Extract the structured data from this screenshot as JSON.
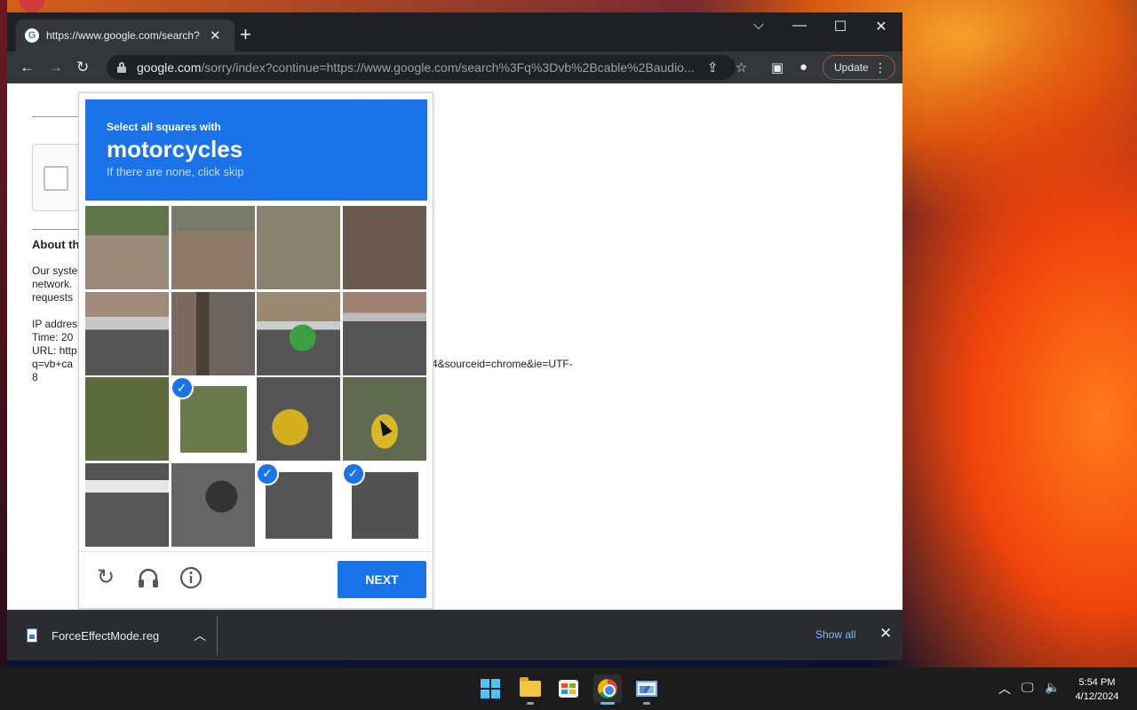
{
  "browser": {
    "tab_title": "https://www.google.com/search?",
    "favicon_letter": "G",
    "url_host": "google.com",
    "url_rest": "/sorry/index?continue=https://www.google.com/search%3Fq%3Dvb%2Bcable%2Baudio...",
    "update_label": "Update"
  },
  "page": {
    "about_heading": "About th",
    "p1": "Our syste",
    "p2": "network.",
    "p3": "requests",
    "ip": "IP addres",
    "time": "Time: 20",
    "url": "URL: http",
    "q": "q=vb+ca",
    "eight": "8",
    "url_tail": "4&sourceid=chrome&ie=UTF-"
  },
  "captcha": {
    "instruction": "Select all squares with",
    "object": "motorcycles",
    "subtext": "If there are none, click skip",
    "next_label": "NEXT",
    "selected_tiles": [
      9,
      14,
      15
    ]
  },
  "downloads": {
    "file_name": "ForceEffectMode.reg",
    "show_all": "Show all"
  },
  "taskbar": {
    "time": "5:54 PM",
    "date": "4/12/2024"
  }
}
